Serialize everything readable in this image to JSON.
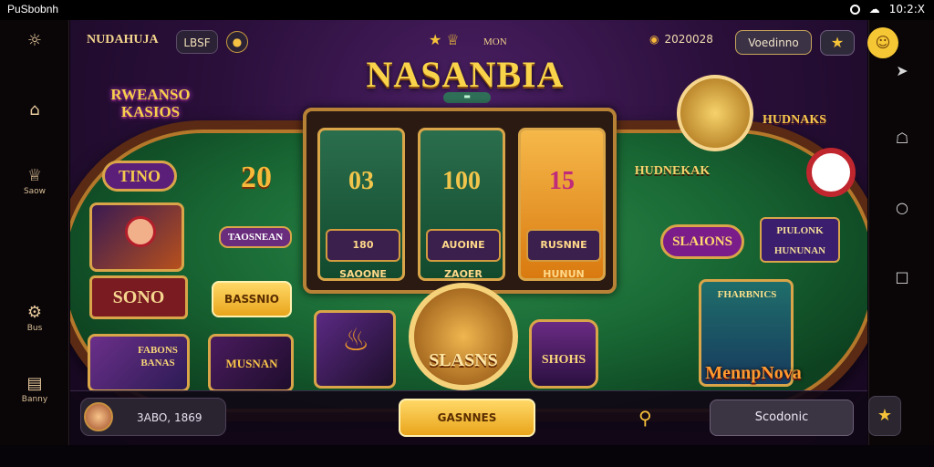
{
  "status_bar": {
    "app_name": "PuSbobnh",
    "time": "10:2:X"
  },
  "header": {
    "brand": "NUDAHUJA",
    "tag": "LBSF",
    "title": "NASANBIA",
    "crown_label": "MON",
    "balance": "2020028",
    "button": "Voedinno"
  },
  "left_nav": [
    {
      "icon": "compass-icon",
      "label": ""
    },
    {
      "icon": "home-icon",
      "label": ""
    },
    {
      "icon": "trophy-icon",
      "label": "Saow"
    },
    {
      "icon": "gear-icon",
      "label": "Bus"
    },
    {
      "icon": "chat-icon",
      "label": "Banny"
    }
  ],
  "banners": {
    "top_left": "RWEANSO KASIOS",
    "tag_left": "TINO",
    "left_value": "20",
    "left_label": "TAOSNEAN",
    "sono": "SONO",
    "basic": "BASSNIO",
    "right_top": "HUDNAKS",
    "right_mid": "HUDNEKAK",
    "right_slions": "SLAIONS",
    "right_panel": "PIULONK HUNUNAN",
    "bottom_right": "MennpNova"
  },
  "reels": [
    {
      "value": "03",
      "label": "180 SAOONE"
    },
    {
      "value": "100",
      "label": "AUOINE ZAOER"
    },
    {
      "value": "15",
      "label": "RUSNNE HUNUN"
    }
  ],
  "tiles": {
    "card1": "FABONS BANAS",
    "card2": "MUSNAN",
    "center": "SLASNS",
    "right": "SHOHS",
    "jackpot": "FHARBNICS"
  },
  "bottom": {
    "stats": "3ABO, 1869",
    "primary_button": "GASNNES",
    "secondary_button": "Scodonic"
  },
  "colors": {
    "accent": "#f6c243",
    "felt": "#196834",
    "wood": "#5a2a14",
    "purple": "#2a0f3a"
  }
}
